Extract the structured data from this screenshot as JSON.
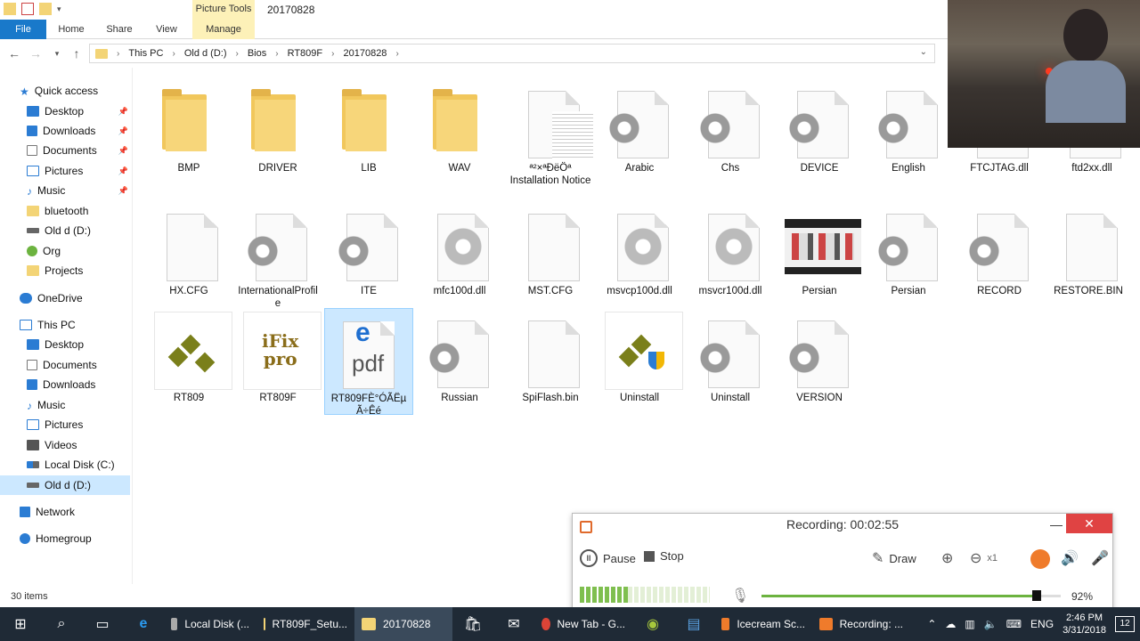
{
  "ribbon": {
    "picture_tools": "Picture Tools",
    "title": "20170828",
    "tabs": [
      "File",
      "Home",
      "Share",
      "View",
      "Manage"
    ]
  },
  "breadcrumb": [
    "This PC",
    "Old d (D:)",
    "Bios",
    "RT809F",
    "20170828"
  ],
  "nav": {
    "quick_access": "Quick access",
    "quick_items": [
      "Desktop",
      "Downloads",
      "Documents",
      "Pictures",
      "Music",
      "bluetooth",
      "Old d (D:)",
      "Org",
      "Projects"
    ],
    "onedrive": "OneDrive",
    "this_pc": "This PC",
    "pc_items": [
      "Desktop",
      "Documents",
      "Downloads",
      "Music",
      "Pictures",
      "Videos",
      "Local Disk (C:)",
      "Old d (D:)"
    ],
    "network": "Network",
    "homegroup": "Homegroup"
  },
  "files": [
    {
      "name": "BMP",
      "type": "folder"
    },
    {
      "name": "DRIVER",
      "type": "folder"
    },
    {
      "name": "LIB",
      "type": "folder"
    },
    {
      "name": "WAV",
      "type": "folder"
    },
    {
      "name": "ª²×ªÐëÖª Installation Notice",
      "type": "text"
    },
    {
      "name": "Arabic",
      "type": "config"
    },
    {
      "name": "Chs",
      "type": "config"
    },
    {
      "name": "DEVICE",
      "type": "config"
    },
    {
      "name": "English",
      "type": "config"
    },
    {
      "name": "FTCJTAG.dll",
      "type": "dll"
    },
    {
      "name": "ftd2xx.dll",
      "type": "dll"
    },
    {
      "name": "HX.CFG",
      "type": "blank"
    },
    {
      "name": "InternationalProfile",
      "type": "config"
    },
    {
      "name": "ITE",
      "type": "config"
    },
    {
      "name": "mfc100d.dll",
      "type": "dll"
    },
    {
      "name": "MST.CFG",
      "type": "blank"
    },
    {
      "name": "msvcp100d.dll",
      "type": "dll"
    },
    {
      "name": "msvcr100d.dll",
      "type": "dll"
    },
    {
      "name": "Persian",
      "type": "image"
    },
    {
      "name": "Persian",
      "type": "config"
    },
    {
      "name": "RECORD",
      "type": "config"
    },
    {
      "name": "RESTORE.BIN",
      "type": "blank"
    },
    {
      "name": "RT809",
      "type": "app-rt"
    },
    {
      "name": "RT809F",
      "type": "app-ifix"
    },
    {
      "name": "RT809FÈ°ÓÃËµÃ÷Êé",
      "type": "pdf"
    },
    {
      "name": "Russian",
      "type": "config"
    },
    {
      "name": "SpiFlash.bin",
      "type": "blank"
    },
    {
      "name": "Uninstall",
      "type": "app-rt-shield"
    },
    {
      "name": "Uninstall",
      "type": "config"
    },
    {
      "name": "VERSION",
      "type": "config"
    }
  ],
  "status": "30 items",
  "recorder": {
    "title": "Recording:  00:02:55",
    "pause": "Pause",
    "stop": "Stop",
    "draw": "Draw",
    "zoom": "x1",
    "volume_pct": "92%",
    "volume_level": 0.92
  },
  "taskbar": {
    "tasks": [
      "Local Disk (...",
      "RT809F_Setu...",
      "20170828",
      "New Tab - G...",
      "Icecream Sc...",
      "Recording: ..."
    ],
    "lang": "ENG",
    "time": "2:46 PM",
    "date": "3/31/2018",
    "notifications": "12"
  },
  "colors": {
    "accent": "#1979ca",
    "folder": "#f1c75c",
    "taskbar": "#1f2a36",
    "selection": "#cce8ff"
  }
}
